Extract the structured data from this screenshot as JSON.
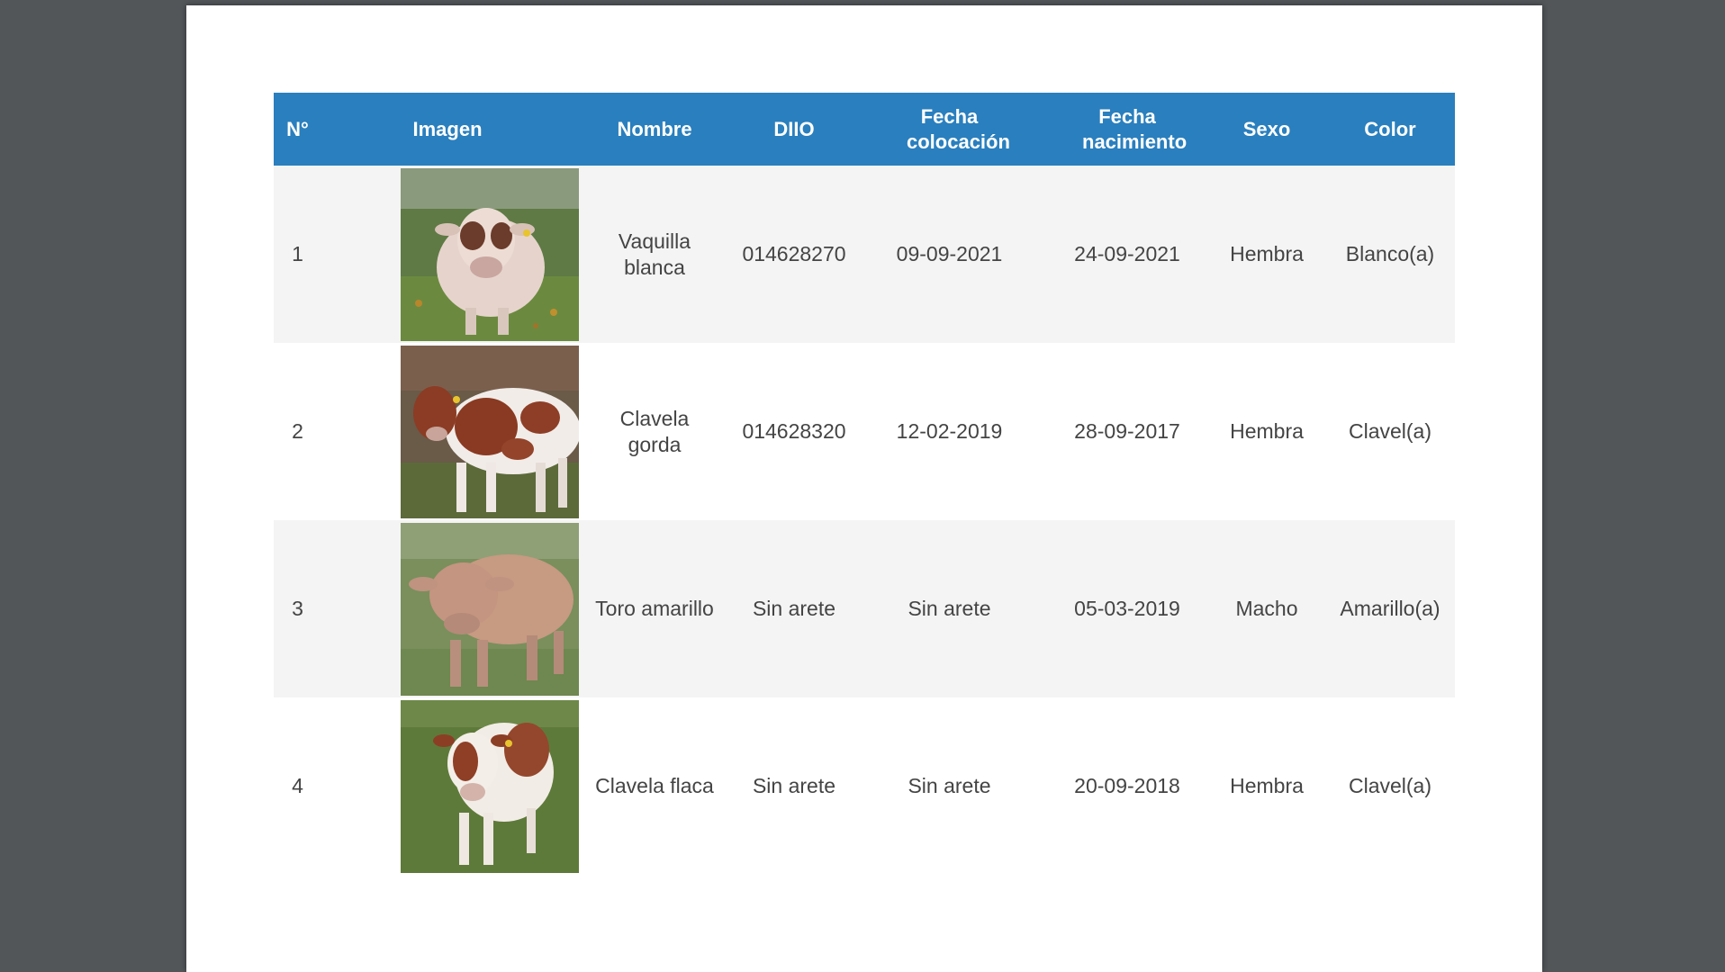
{
  "headers": {
    "num": "N°",
    "image": "Imagen",
    "name": "Nombre",
    "diio": "DIIO",
    "tag_date": "Fecha colocación",
    "birth_date": "Fecha nacimiento",
    "sex": "Sexo",
    "color": "Color"
  },
  "rows": [
    {
      "num": "1",
      "name": "Vaquilla blanca",
      "diio": "014628270",
      "tag_date": "09-09-2021",
      "birth_date": "24-09-2021",
      "sex": "Hembra",
      "color": "Blanco(a)",
      "image": "cow-photo"
    },
    {
      "num": "2",
      "name": "Clavela gorda",
      "diio": "014628320",
      "tag_date": "12-02-2019",
      "birth_date": "28-09-2017",
      "sex": "Hembra",
      "color": "Clavel(a)",
      "image": "cow-photo"
    },
    {
      "num": "3",
      "name": "Toro amarillo",
      "diio": "Sin arete",
      "tag_date": "Sin arete",
      "birth_date": "05-03-2019",
      "sex": "Macho",
      "color": "Amarillo(a)",
      "image": "bull-photo"
    },
    {
      "num": "4",
      "name": "Clavela flaca",
      "diio": "Sin arete",
      "tag_date": "Sin arete",
      "birth_date": "20-09-2018",
      "sex": "Hembra",
      "color": "Clavel(a)",
      "image": "cow-photo"
    }
  ],
  "colors": {
    "header_bg": "#2a7fbe",
    "header_text": "#ffffff",
    "row_alt_bg": "#f4f4f4",
    "text": "#444444",
    "viewer_bg": "#525659"
  }
}
